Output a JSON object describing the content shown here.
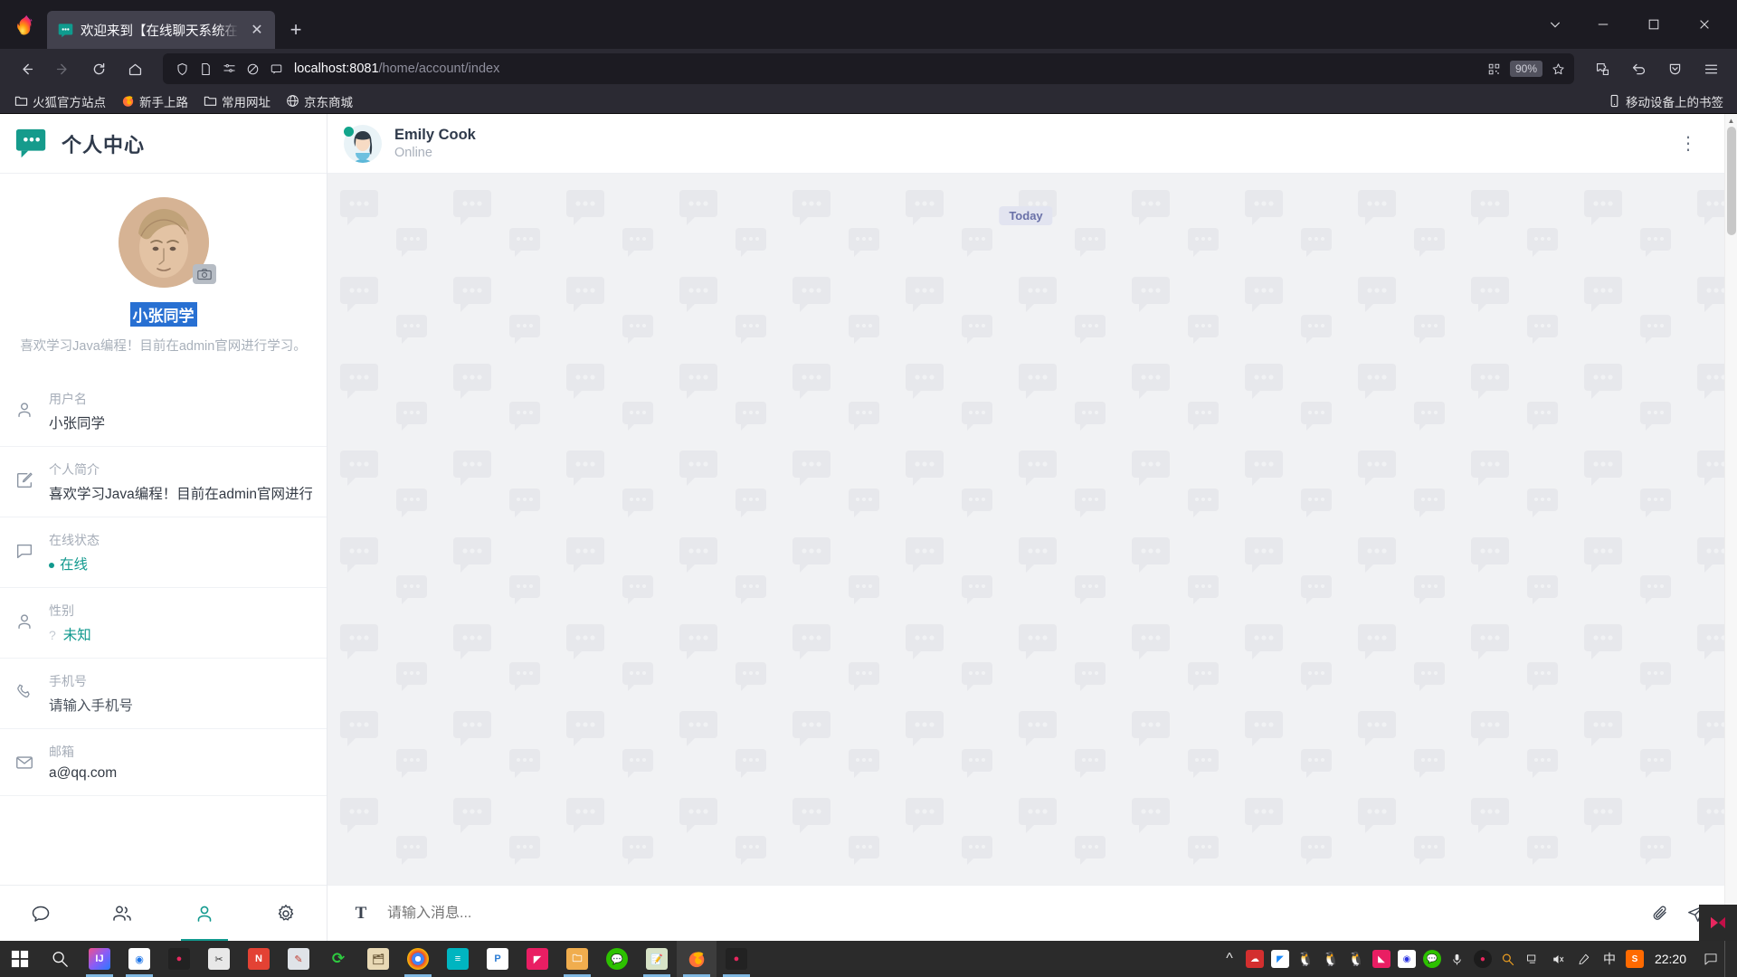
{
  "browser": {
    "tab": {
      "title": "欢迎来到【在线聊天系统在线聊",
      "favicon_name": "chat-bubble-favicon",
      "close_label": "✕"
    },
    "newtab_label": "+",
    "window_controls": {
      "list_all_tabs": "⌄",
      "minimize": "—",
      "maximize": "▢",
      "close": "✕"
    },
    "nav": {
      "back": "←",
      "forward": "→",
      "reload": "⟳",
      "home": "⌂"
    },
    "url": {
      "host": "localhost:8081",
      "path": "/home/account/index",
      "zoom_level": "90%"
    },
    "bookmarks": [
      {
        "label": "火狐官方站点",
        "icon": "folder-icon"
      },
      {
        "label": "新手上路",
        "icon": "firefox-icon"
      },
      {
        "label": "常用网址",
        "icon": "folder-icon"
      },
      {
        "label": "京东商城",
        "icon": "globe-icon"
      }
    ],
    "bookmarks_right": {
      "label": "移动设备上的书签",
      "icon": "mobile-icon"
    }
  },
  "sidebar": {
    "brand": "个人中心",
    "profile": {
      "name": "小张同学",
      "bio": "喜欢学习Java编程！目前在admin官网进行学习。",
      "avatar_name": "user-avatar",
      "camera_badge": "camera-icon"
    },
    "info_rows": [
      {
        "icon": "person-icon",
        "label": "用户名",
        "value": "小张同学",
        "style": "normal"
      },
      {
        "icon": "edit-icon",
        "label": "个人简介",
        "value": "喜欢学习Java编程！目前在admin官网进行",
        "style": "normal"
      },
      {
        "icon": "chat-icon",
        "label": "在线状态",
        "value": "在线",
        "style": "accent-dot"
      },
      {
        "icon": "person-icon",
        "label": "性别",
        "value": "未知",
        "style": "accent-question"
      },
      {
        "icon": "phone-icon",
        "label": "手机号",
        "value": "请输入手机号",
        "style": "placeholder"
      },
      {
        "icon": "mail-icon",
        "label": "邮箱",
        "value": "a@qq.com",
        "style": "normal"
      }
    ],
    "nav": [
      {
        "icon": "chat-bubble-icon",
        "name": "messages",
        "active": false
      },
      {
        "icon": "contacts-icon",
        "name": "contacts",
        "active": false
      },
      {
        "icon": "profile-icon",
        "name": "profile",
        "active": true
      },
      {
        "icon": "settings-gear-icon",
        "name": "settings",
        "active": false
      }
    ]
  },
  "chat": {
    "contact_name": "Emily Cook",
    "contact_status": "Online",
    "more_menu": "⋮",
    "date_divider": "Today",
    "composer": {
      "format_icon": "T",
      "placeholder": "请输入消息...",
      "attach_icon": "paperclip-icon",
      "send_icon": "send-icon"
    }
  },
  "taskbar": {
    "clock": "22:20",
    "language_indicator": "中",
    "start_icon": "windows-start-icon",
    "search_icon": "search-icon",
    "tray_expand": "^"
  },
  "colors": {
    "accent_teal": "#11998e",
    "selection_blue": "#2870d2",
    "chrome_dark": "#2b2a33",
    "chat_bg": "#f1f2f4",
    "today_chip_bg": "#e2e4f0"
  }
}
